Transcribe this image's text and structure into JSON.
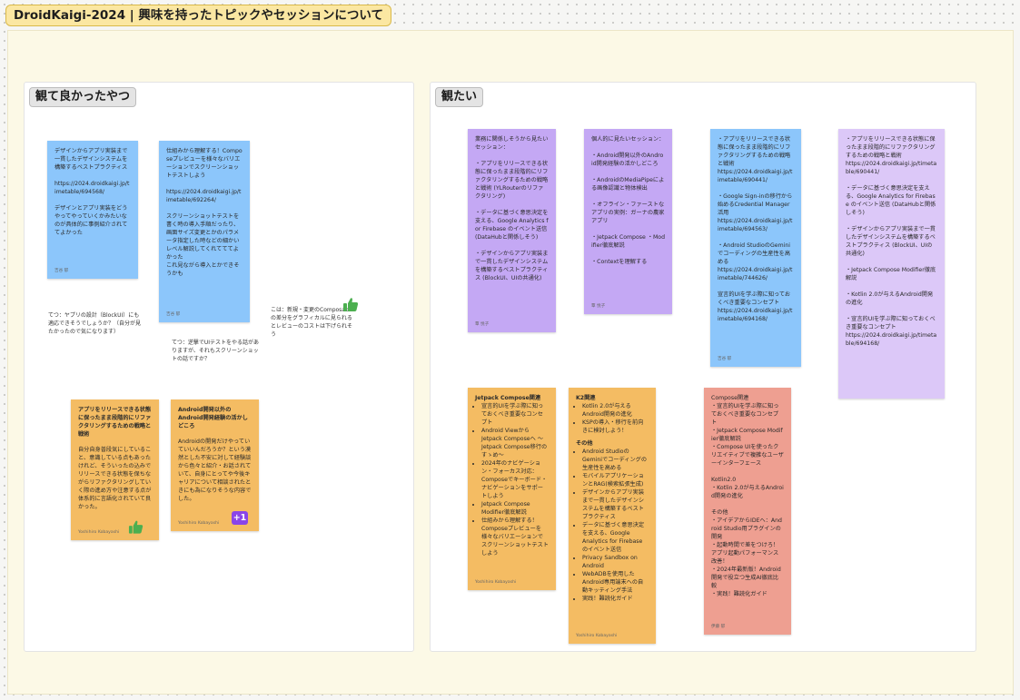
{
  "board": {
    "title": "DroidKaigi-2024 | 興味を持ったトピックやセッションについて"
  },
  "sections": {
    "left": {
      "label": "観て良かったやつ"
    },
    "right": {
      "label": "観たい"
    }
  },
  "stickies": {
    "s1": {
      "body": "デザインからアプリ実装まで一貫したデザインシステムを構築するベストプラクティス\n\nhttps://2024.droidkaigi.jp/timetable/694568/\n\nデザインとアプリ実装をどうやってやっていくかみたいなのが具体的に事例紹介されててよかった",
      "author": "吉谷 郁"
    },
    "s2": {
      "body": "仕組みから理解する！Composeプレビューを様々なバリエーションでスクリーンショットテストしよう\n\nhttps://2024.droidkaigi.jp/timetable/692264/\n\nスクリーンショットテストを書く時の導入手順だったり、画面サイズ変更とかのパラメータ指定した時などの細かいレベル解説してくれてててよかった\nこれ見ながら導入とかできそうかも",
      "author": "吉谷 郁"
    },
    "s3": {
      "title": "アプリをリリースできる状態に保ったまま段階的にリファクタリングするための戦略と戦術",
      "body": "自分自身普段気にしていること、意識している点もあったけれど、そういったの込みでリリースできる状態を保ちながらリファクタリングしていく際の進め方や注意する点が体系的に言語化されていて良かった。",
      "author": "Yoshihiro Kobayashi"
    },
    "s4": {
      "title": "Android開発以外のAndroid開発経験の活かしどころ",
      "body": "Androidの開発だけやっていていいんだろうか？という漠然とした不安に対して経験談から色々と紹介・お話されていて、自身にとってや今後キャリアについて相談されたときにも為になりそうな内容でした。",
      "author": "Yoshihiro Kobayashi"
    },
    "p1": {
      "body": "業務に関係しそうから見たいセッション：\n\n・アプリをリリースできる状態に保ったまま段階的にリファクタリングするための戦略と戦術 (YLRouterのリファクタリング)\n\n・データに基づく意思決定を支える、Google Analytics for Firebase のイベント送信 (DataHubと関係しそう)\n\n・デザインからアプリ実装まで一貫したデザインシステムを構築するベストプラクティス (BlockUI、UIの共通化)",
      "author": "覃 悦子"
    },
    "p2": {
      "body": "個人的に見たいセッション：\n\n・Android開発以外のAndroid開発経験の活かしどころ\n\n・AndroidのMediaPipeによる画像認識と物体検出\n\n・オフライン・ファーストなアプリの実例：ガーナの農家アプリ\n\n・Jetpack Compose ・Modifier徹底解説\n\n・Contextを理解する",
      "author": "覃 悦子"
    },
    "b3": {
      "body": "・アプリをリリースできる状態に保ったまま段階的にリファクタリングするための戦略と戦術\nhttps://2024.droidkaigi.jp/timetable/690441/\n\n・Google Sign-inの移行から始めるCredential Manager活用\nhttps://2024.droidkaigi.jp/timetable/694563/\n\n・Android StudioのGeminiでコーディングの生産性を高める\nhttps://2024.droidkaigi.jp/timetable/744626/\n\n宣言的UIを学ぶ際に知っておくべき重要なコンセプト\nhttps://2024.droidkaigi.jp/timetable/694168/",
      "author": "吉谷 郁"
    },
    "l4": {
      "body": "・アプリをリリースできる状態に保ったまま段階的にリファクタリングするための戦略と戦術\nhttps://2024.droidkaigi.jp/timetable/690441/\n\n・データに基づく意思決定を支える、Google Analytics for Firebase のイベント送信 (DataHubと関係しそう)\n\n・デザインからアプリ実装まで一貫したデザインシステムを構築するベストプラクティス (BlockUI、UIの共通化)\n\n・Jetpack Compose Modifier徹底解説\n\n・Kotlin 2.0が与えるAndroid開発の進化\n\n・宣言的UIを学ぶ際に知っておくべき重要なコンセプト\nhttps://2024.droidkaigi.jp/timetable/694168/"
    },
    "o1": {
      "heading": "Jetpack Compose関連",
      "items": [
        "宣言的UIを学ぶ際に知っておくべき重要なコンセプト",
        "Android Viewから Jetpack Composeへ 〜Jetpack Compose移行のすゝめ〜",
        "2024年のナビゲーション・フォーカス対応：Composeでキーボード・ナビゲーションをサポートしよう",
        "Jetpack Compose Modifier徹底解説",
        "仕組みから理解する！Composeプレビューを様々なバリエーションでスクリーンショットテストしよう"
      ],
      "author": "Yoshihiro Kobayashi"
    },
    "o2": {
      "heading": "K2関連",
      "items": [
        "Kotlin 2.0が与えるAndroid開発の進化",
        "KSPの導入・移行を前向きに検討しよう！"
      ],
      "heading2": "その他",
      "items2": [
        "Android StudioのGeminiでコーディングの生産性を高める",
        "モバイルアプリケーションとRAG(検索拡張生成)",
        "デザインからアプリ実装まで一貫したデザインシステムを構築するベストプラクティス",
        "データに基づく意思決定を支える、Google Analytics for Firebase のイベント送信",
        "Privacy Sandbox on Android",
        "WebADBを使用したAndroid専用端末への自動キッティング手法",
        "実践！難読化ガイド"
      ],
      "author": "Yoshihiro Kobayashi"
    },
    "r3": {
      "body": "Compose関連\n・宣言的UIを学ぶ際に知っておくべき重要なコンセプト\n・Jetpack Compose Modifier徹底解説\n・Compose UIを使ったクリエイティブで複雑なユーザーインターフェース\n\nKotlin2.0\n・Kotlin 2.0が与えるAndroid開発の進化\n\nその他\n・アイデアからIDEへ：Android Studio用プラグインの開発\n・起動時間で差をつけろ！アプリ起動パフォーマンス改善！\n・2024年最新版！Android開発で役立つ生成AI徹底比較\n・実践！難読化ガイド",
      "author": "伊藤 郁"
    }
  },
  "notes": {
    "n1": "てつ：ヤプリの設計（BlockUI）にも適応できそうでしょうか？（自分が見たかったので気になります）",
    "n2": "てつ：逆撃でUIテストをやる話がありますが、それもスクリーンショットの話ですか？",
    "n3": "こは：新規・変更のComposableの差分をグラフィカルに見られるとレビューのコストは下げられそう"
  },
  "reaction": {
    "label": "+1"
  },
  "colors": {
    "blue": "#8cc6fb",
    "purple": "#c4a8f4",
    "orange": "#f4bc63",
    "lavender": "#dcc8f8",
    "salmon": "#ee9f91",
    "title_bg": "#fbe7a2"
  }
}
